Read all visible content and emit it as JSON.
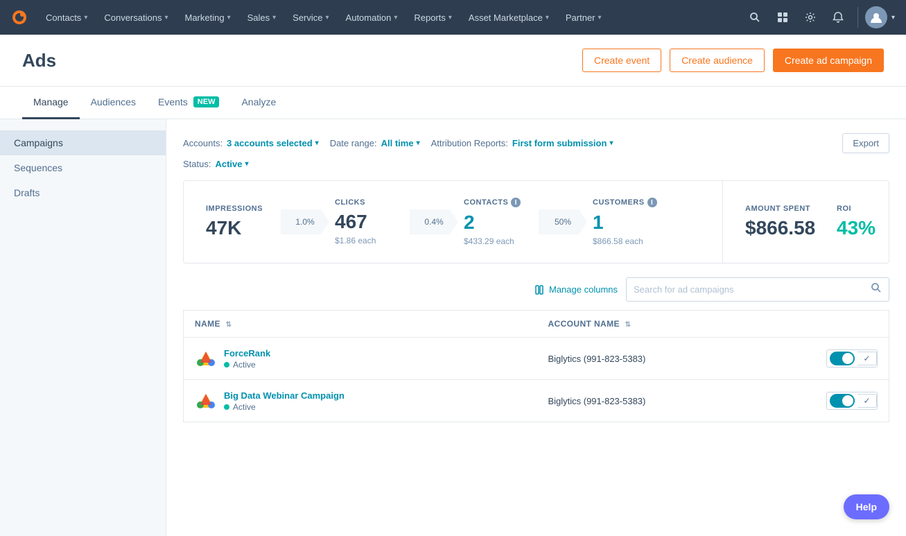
{
  "topnav": {
    "logo": "🍊",
    "items": [
      {
        "label": "Contacts",
        "id": "contacts"
      },
      {
        "label": "Conversations",
        "id": "conversations"
      },
      {
        "label": "Marketing",
        "id": "marketing"
      },
      {
        "label": "Sales",
        "id": "sales"
      },
      {
        "label": "Service",
        "id": "service"
      },
      {
        "label": "Automation",
        "id": "automation"
      },
      {
        "label": "Reports",
        "id": "reports"
      },
      {
        "label": "Asset Marketplace",
        "id": "asset-marketplace"
      },
      {
        "label": "Partner",
        "id": "partner"
      }
    ]
  },
  "page": {
    "title": "Ads",
    "buttons": {
      "create_event": "Create event",
      "create_audience": "Create audience",
      "create_campaign": "Create ad campaign"
    },
    "tabs": [
      {
        "label": "Manage",
        "id": "manage",
        "active": true,
        "badge": null
      },
      {
        "label": "Audiences",
        "id": "audiences",
        "active": false,
        "badge": null
      },
      {
        "label": "Events",
        "id": "events",
        "active": false,
        "badge": "NEW"
      },
      {
        "label": "Analyze",
        "id": "analyze",
        "active": false,
        "badge": null
      }
    ]
  },
  "sidebar": {
    "items": [
      {
        "label": "Campaigns",
        "id": "campaigns",
        "active": true
      },
      {
        "label": "Sequences",
        "id": "sequences",
        "active": false
      },
      {
        "label": "Drafts",
        "id": "drafts",
        "active": false
      }
    ]
  },
  "filters": {
    "accounts_label": "Accounts:",
    "accounts_value": "3 accounts selected",
    "date_label": "Date range:",
    "date_value": "All time",
    "attribution_label": "Attribution Reports:",
    "attribution_value": "First form submission",
    "status_label": "Status:",
    "status_value": "Active",
    "export_btn": "Export"
  },
  "stats": {
    "impressions_label": "IMPRESSIONS",
    "impressions_value": "47K",
    "impressions_rate": "1.0%",
    "clicks_label": "CLICKS",
    "clicks_value": "467",
    "clicks_each": "$1.86 each",
    "clicks_rate": "0.4%",
    "contacts_label": "CONTACTS",
    "contacts_value": "2",
    "contacts_each": "$433.29 each",
    "contacts_rate": "50%",
    "customers_label": "CUSTOMERS",
    "customers_value": "1",
    "customers_each": "$866.58 each",
    "amount_label": "AMOUNT SPENT",
    "amount_value": "$866.58",
    "roi_label": "ROI",
    "roi_value": "43%"
  },
  "table": {
    "manage_columns": "Manage columns",
    "search_placeholder": "Search for ad campaigns",
    "columns": [
      {
        "label": "NAME",
        "id": "name"
      },
      {
        "label": "ACCOUNT NAME",
        "id": "account_name"
      }
    ],
    "rows": [
      {
        "name": "ForceRank",
        "status": "Active",
        "account_name": "Biglytics (991-823-5383)",
        "icon_type": "google"
      },
      {
        "name": "Big Data Webinar Campaign",
        "status": "Active",
        "account_name": "Biglytics (991-823-5383)",
        "icon_type": "google"
      }
    ]
  },
  "help_label": "Help"
}
